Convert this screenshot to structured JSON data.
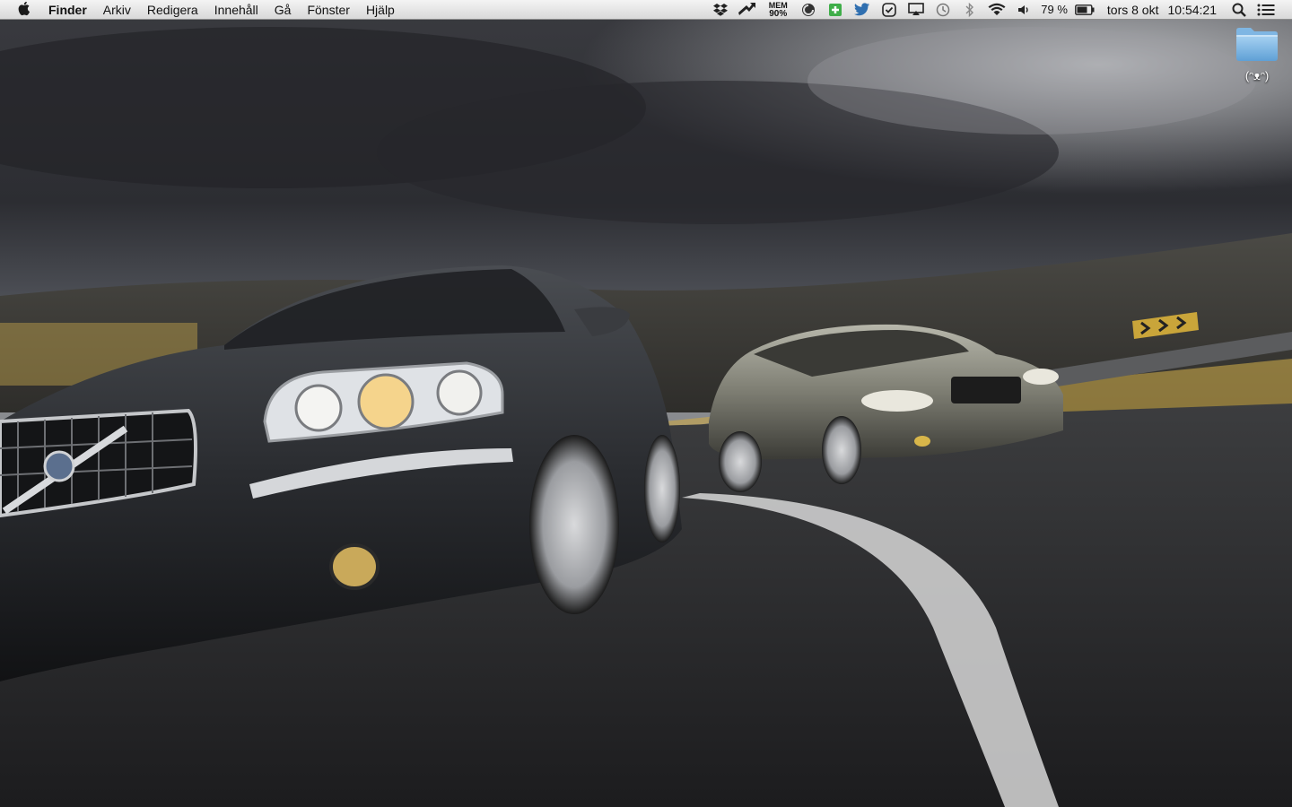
{
  "menubar": {
    "apple_icon": "apple-logo-icon",
    "app_name": "Finder",
    "menus": [
      "Arkiv",
      "Redigera",
      "Innehåll",
      "Gå",
      "Fönster",
      "Hjälp"
    ],
    "status": {
      "mem_label": "MEM",
      "mem_value": "90%",
      "battery_percent": "79 %",
      "datetime": "tors 8 okt",
      "time": "10:54:21"
    }
  },
  "desktop": {
    "folder_label": "(ᵔᴥᵔ)"
  }
}
